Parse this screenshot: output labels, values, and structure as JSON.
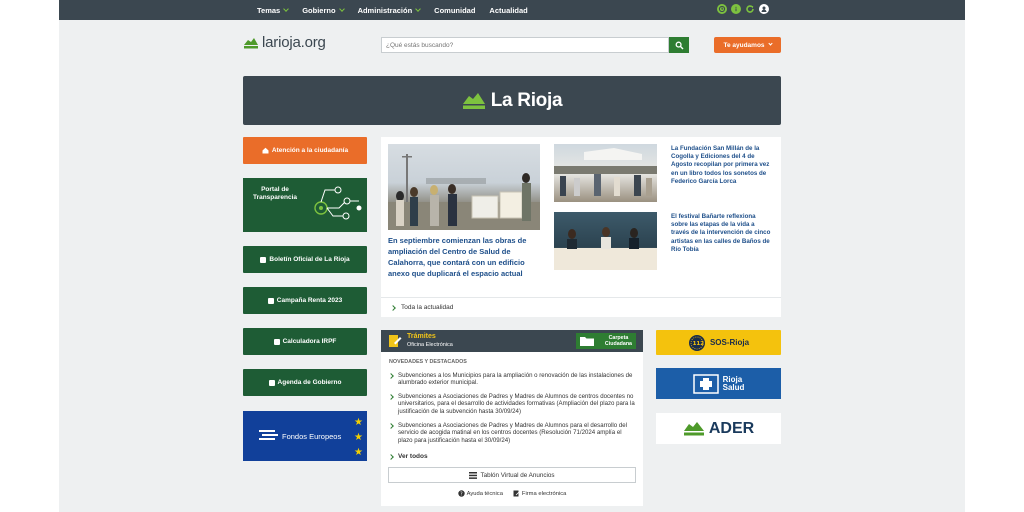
{
  "topnav": {
    "items": [
      {
        "label": "Temas",
        "dropdown": true
      },
      {
        "label": "Gobierno",
        "dropdown": true
      },
      {
        "label": "Administración",
        "dropdown": true
      },
      {
        "label": "Comunidad",
        "dropdown": false
      },
      {
        "label": "Actualidad",
        "dropdown": false
      }
    ],
    "icons": [
      "clock-icon",
      "info-icon",
      "refresh-icon",
      "user-icon"
    ]
  },
  "header": {
    "brand": "larioja.org",
    "search_placeholder": "¿Qué estás buscando?",
    "help_label": "Te ayudamos"
  },
  "banner": {
    "title": "La Rioja"
  },
  "left_column": {
    "atencion": "Atención a la ciudadanía",
    "transparencia": "Portal de Transparencia",
    "boletin": "Boletín Oficial de La Rioja",
    "renta": "Campaña Renta 2023",
    "irpf": "Calculadora IRPF",
    "agenda": "Agenda de Gobierno",
    "fondos": "Fondos Europeos"
  },
  "news": {
    "main_headline": "En septiembre comienzan las obras de ampliación del Centro de Salud de Calahorra, que contará con un edificio anexo que duplicará el espacio actual",
    "side": [
      {
        "headline": "La Fundación San Millán de la Cogolla y Ediciones del 4 de Agosto recopilan por primera vez en un libro todos los sonetos de Federico García Lorca"
      },
      {
        "headline": "El festival Bañarte reflexiona sobre las etapas de la vida a través de la intervención de cinco artistas en las calles de Baños de Río Tobía"
      }
    ],
    "all_link": "Toda la actualidad"
  },
  "tramites": {
    "title": "Trámites",
    "subtitle": "Oficina Electrónica",
    "carpeta_line1": "Carpeta",
    "carpeta_line2": "Ciudadana",
    "section_title": "NOVEDADES Y DESTACADOS",
    "items": [
      "Subvenciones a los Municipios para la ampliación o renovación de las instalaciones de alumbrado exterior municipal.",
      "Subvenciones a Asociaciones de Padres y Madres de Alumnos de centros docentes no universitarios, para el desarrollo de actividades formativas (Ampliación del plazo para la justificación de la subvención hasta 30/09/24)",
      "Subvenciones a Asociaciones de Padres y Madres de Alumnos para el desarrollo del servicio de acogida matinal en los centros docentes (Resolución 71/2024 amplía el plazo para justificación hasta el 30/09/24)"
    ],
    "ver_todos": "Ver todos",
    "tablon": "Tablón Virtual de Anuncios",
    "ayuda": "Ayuda técnica",
    "firma": "Firma electrónica"
  },
  "right_column": {
    "sos": "SOS-Rioja",
    "salud_line1": "Rioja",
    "salud_line2": "Salud",
    "ader": "ADER"
  },
  "colors": {
    "nav_bg": "#3b4750",
    "accent_green": "#2e7d32",
    "dark_green": "#1e5c35",
    "orange": "#ea6d29",
    "link_blue": "#1e4f8a",
    "sos_yellow": "#f4c20d",
    "salud_blue": "#1c5ea8",
    "fondos_blue": "#11409a"
  }
}
